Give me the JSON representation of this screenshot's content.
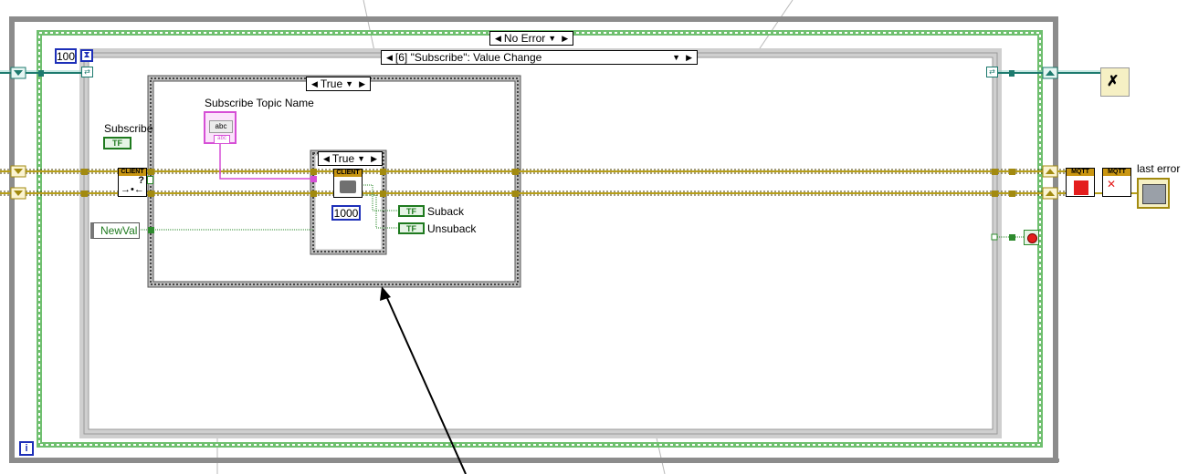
{
  "while_loop": {
    "iteration_terminal": "i"
  },
  "case_structures": {
    "outer_case": {
      "selector": "No Error"
    },
    "event_structure": {
      "selector": "[6] \"Subscribe\": Value Change"
    },
    "inner_case": {
      "selector": "True"
    },
    "innermost_case": {
      "selector": "True"
    }
  },
  "constants": {
    "timeout": "100",
    "wait": "1000"
  },
  "labels": {
    "subscribe_topic": "Subscribe Topic Name",
    "subscribe_bool": "Subscribe",
    "new_val": "NewVal",
    "suback": "Suback",
    "unsuback": "Unsuback",
    "last_error": "last error",
    "client": "CLIENT",
    "mqtt": "MQTT",
    "abc": "abc",
    "tf": "TF",
    "query": "?"
  },
  "colors": {
    "loop_frame": "#8c8c8c",
    "event_frame": "#e1e1e1",
    "case_frame": "#a6a6a6",
    "error_wire": "#b8a019",
    "refnum_wire": "#1d7a6e",
    "string_wire": "#d64fd6",
    "boolean_wire": "#2e8b2e",
    "numeric_blue": "#1d2fb8",
    "stop_red": "#e41d1d"
  },
  "icons": [
    "hourglass-icon",
    "timeout-icon",
    "close-connection-icon",
    "stop-icon",
    "error-cluster-icon",
    "stop-button-icon"
  ]
}
